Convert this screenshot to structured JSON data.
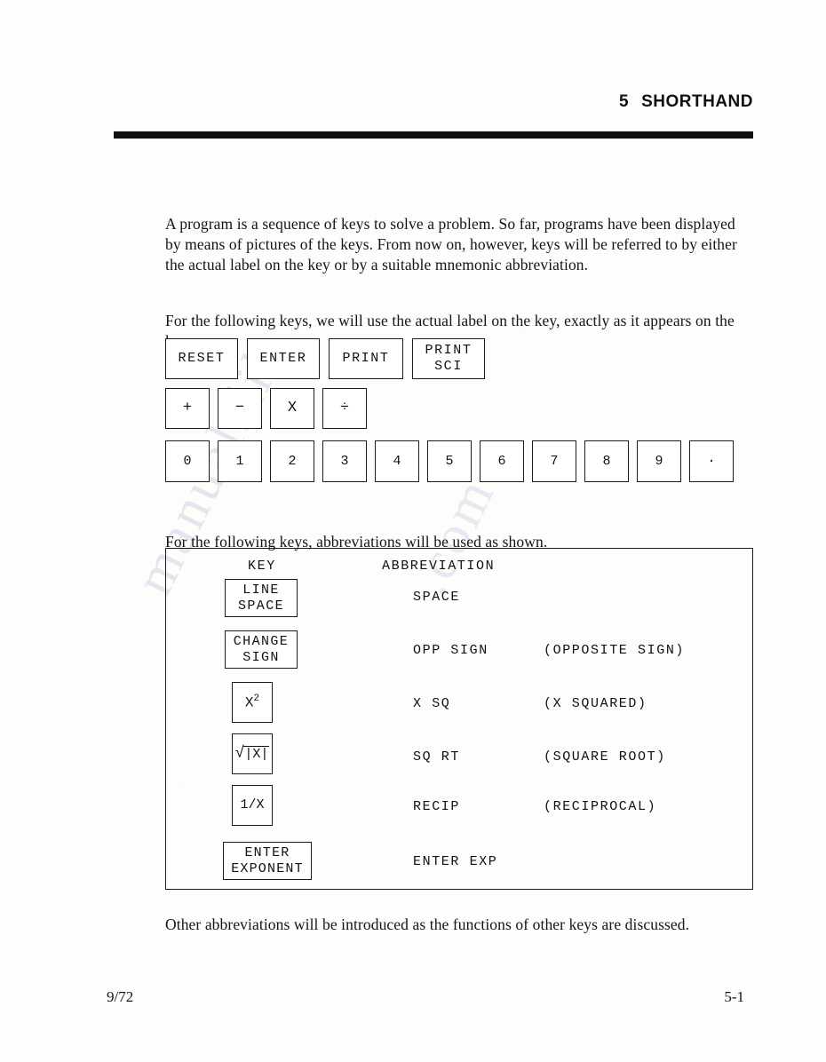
{
  "header": {
    "chapter_number": "5",
    "chapter_title": "SHORTHAND"
  },
  "body": {
    "intro": "A program is a sequence of keys to solve a problem.  So far, programs have been displayed by means of pictures of the keys.  From now on, however, keys will be referred to by either the actual label on the key or by a suitable mnemonic abbreviation.",
    "actual_label_note": "For the following keys, we will use the actual label on the key, exactly as it appears on the key.",
    "abbrev_note": "For the following keys, abbreviations will be used as shown.",
    "closing": "Other abbreviations will be introduced as the functions of other keys are discussed."
  },
  "word_keys": [
    {
      "label": "RESET"
    },
    {
      "label": "ENTER"
    },
    {
      "label": "PRINT"
    },
    {
      "label": "PRINT\nSCI"
    }
  ],
  "operator_keys": [
    {
      "label": "+"
    },
    {
      "label": "−"
    },
    {
      "label": "X"
    },
    {
      "label": "÷"
    }
  ],
  "digit_keys": [
    {
      "label": "0"
    },
    {
      "label": "1"
    },
    {
      "label": "2"
    },
    {
      "label": "3"
    },
    {
      "label": "4"
    },
    {
      "label": "5"
    },
    {
      "label": "6"
    },
    {
      "label": "7"
    },
    {
      "label": "8"
    },
    {
      "label": "9"
    },
    {
      "label": "·"
    }
  ],
  "abbrev_table": {
    "headers": {
      "key": "KEY",
      "abbreviation": "ABBREVIATION"
    },
    "rows": [
      {
        "key_label": "LINE\nSPACE",
        "abbreviation": "SPACE",
        "expansion": ""
      },
      {
        "key_label": "CHANGE\nSIGN",
        "abbreviation": "OPP SIGN",
        "expansion": "(OPPOSITE SIGN)"
      },
      {
        "key_label": "X2",
        "abbreviation": "X SQ",
        "expansion": "(X SQUARED)"
      },
      {
        "key_label": "√|X|",
        "abbreviation": "SQ RT",
        "expansion": "(SQUARE ROOT)"
      },
      {
        "key_label": "1/X",
        "abbreviation": "RECIP",
        "expansion": "(RECIPROCAL)"
      },
      {
        "key_label": "ENTER\nEXPONENT",
        "abbreviation": "ENTER EXP",
        "expansion": ""
      }
    ]
  },
  "footer": {
    "date_code": "9/72",
    "page_number": "5-1"
  },
  "watermark": {
    "line1": "manualslib",
    "line2": ".com"
  }
}
